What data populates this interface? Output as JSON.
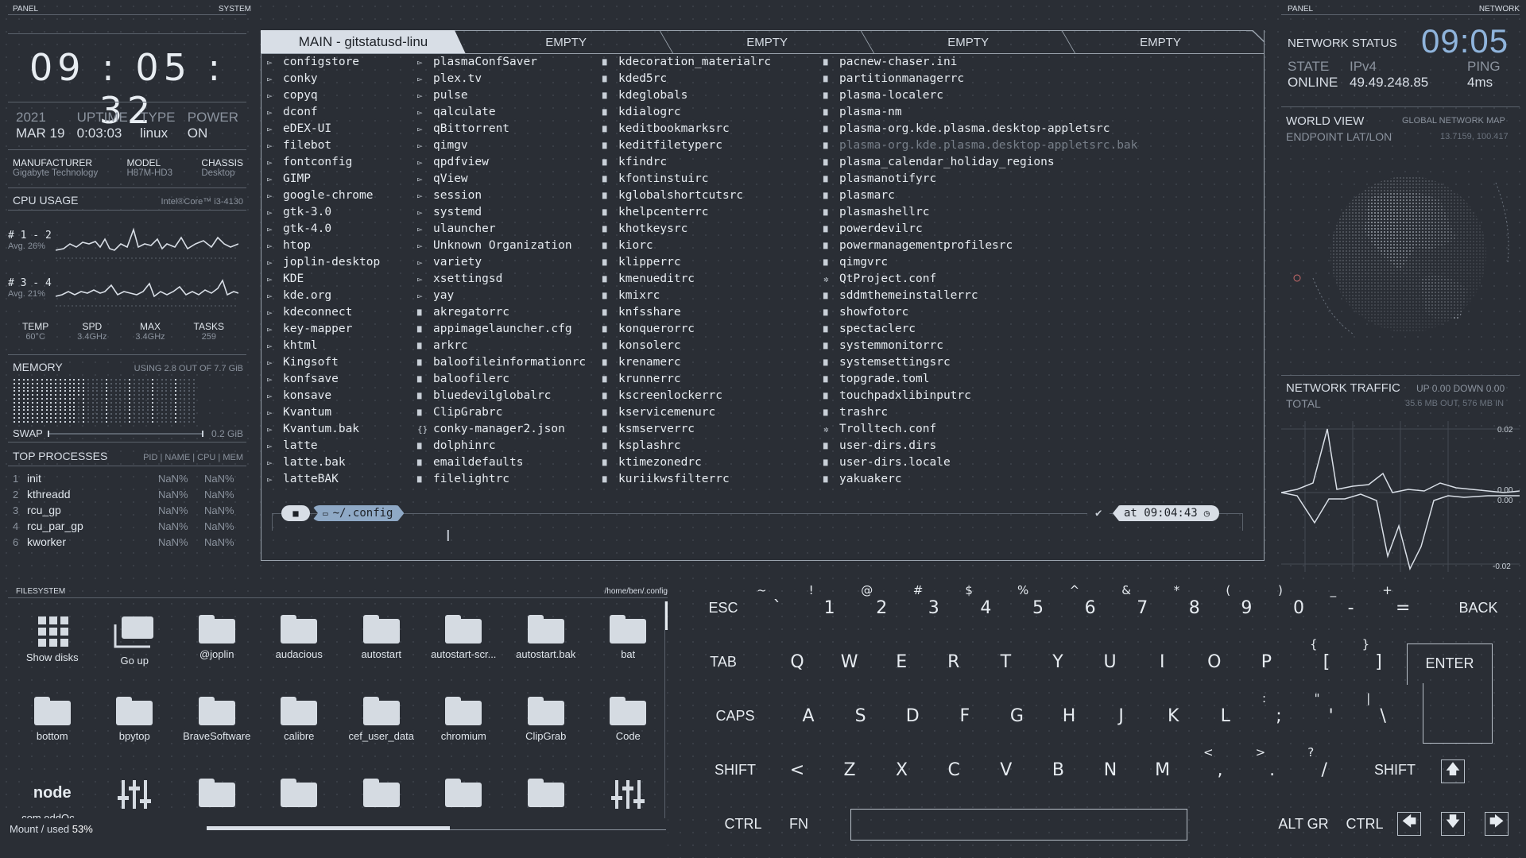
{
  "left_panel": {
    "header_left": "PANEL",
    "header_right": "SYSTEM",
    "clock": [
      "09",
      "05",
      "32"
    ],
    "info": [
      {
        "k": "2021",
        "v": "MAR 19"
      },
      {
        "k": "UPTIME",
        "v": "0:03:03"
      },
      {
        "k": "TYPE",
        "v": "linux"
      },
      {
        "k": "POWER",
        "v": "ON"
      }
    ],
    "hardware": [
      {
        "k": "MANUFACTURER",
        "v": "Gigabyte Technology"
      },
      {
        "k": "MODEL",
        "v": "H87M-HD3"
      },
      {
        "k": "CHASSIS",
        "v": "Desktop"
      }
    ],
    "cpu_title": "CPU USAGE",
    "cpu_model": "Intel®Core™ i3-4130",
    "cpu_rows": [
      {
        "cores": "# 1 - 2",
        "avg": "Avg. 26%"
      },
      {
        "cores": "# 3 - 4",
        "avg": "Avg. 21%"
      }
    ],
    "stats": [
      {
        "k": "TEMP",
        "v": "60°C"
      },
      {
        "k": "SPD",
        "v": "3.4GHz"
      },
      {
        "k": "MAX",
        "v": "3.4GHz"
      },
      {
        "k": "TASKS",
        "v": "259"
      }
    ],
    "memory_title": "MEMORY",
    "memory_usage": "USING 2.8 OUT OF 7.7 GiB",
    "memory_used_fraction": 0.36,
    "swap_label": "SWAP",
    "swap_value": "0.2 GiB",
    "processes_title": "TOP PROCESSES",
    "processes_cols": "PID | NAME | CPU | MEM",
    "processes": [
      {
        "pid": "1",
        "name": "init",
        "cpu": "NaN%",
        "mem": "NaN%"
      },
      {
        "pid": "2",
        "name": "kthreadd",
        "cpu": "NaN%",
        "mem": "NaN%"
      },
      {
        "pid": "3",
        "name": "rcu_gp",
        "cpu": "NaN%",
        "mem": "NaN%"
      },
      {
        "pid": "4",
        "name": "rcu_par_gp",
        "cpu": "NaN%",
        "mem": "NaN%"
      },
      {
        "pid": "6",
        "name": "kworker",
        "cpu": "NaN%",
        "mem": "NaN%"
      }
    ]
  },
  "terminal": {
    "tabs": [
      "MAIN - gitstatusd-linu",
      "EMPTY",
      "EMPTY",
      "EMPTY",
      "EMPTY"
    ],
    "columns": [
      [
        {
          "t": "d",
          "n": "configstore"
        },
        {
          "t": "d",
          "n": "conky"
        },
        {
          "t": "d",
          "n": "copyq"
        },
        {
          "t": "d",
          "n": "dconf"
        },
        {
          "t": "d",
          "n": "eDEX-UI"
        },
        {
          "t": "d",
          "n": "filebot"
        },
        {
          "t": "d",
          "n": "fontconfig"
        },
        {
          "t": "d",
          "n": "GIMP"
        },
        {
          "t": "d",
          "n": "google-chrome"
        },
        {
          "t": "d",
          "n": "gtk-3.0"
        },
        {
          "t": "d",
          "n": "gtk-4.0"
        },
        {
          "t": "d",
          "n": "htop"
        },
        {
          "t": "d",
          "n": "joplin-desktop"
        },
        {
          "t": "d",
          "n": "KDE"
        },
        {
          "t": "d",
          "n": "kde.org"
        },
        {
          "t": "d",
          "n": "kdeconnect"
        },
        {
          "t": "d",
          "n": "key-mapper"
        },
        {
          "t": "d",
          "n": "khtml"
        },
        {
          "t": "d",
          "n": "Kingsoft"
        },
        {
          "t": "d",
          "n": "konfsave"
        },
        {
          "t": "d",
          "n": "konsave"
        },
        {
          "t": "d",
          "n": "Kvantum"
        },
        {
          "t": "d",
          "n": "Kvantum.bak"
        },
        {
          "t": "d",
          "n": "latte"
        },
        {
          "t": "d",
          "n": "latte.bak"
        },
        {
          "t": "d",
          "n": "latteBAK"
        }
      ],
      [
        {
          "t": "d",
          "n": "plasmaConfSaver"
        },
        {
          "t": "d",
          "n": "plex.tv"
        },
        {
          "t": "d",
          "n": "pulse"
        },
        {
          "t": "d",
          "n": "qalculate"
        },
        {
          "t": "d",
          "n": "qBittorrent"
        },
        {
          "t": "d",
          "n": "qimgv"
        },
        {
          "t": "d",
          "n": "qpdfview"
        },
        {
          "t": "d",
          "n": "qView"
        },
        {
          "t": "d",
          "n": "session"
        },
        {
          "t": "d",
          "n": "systemd"
        },
        {
          "t": "d",
          "n": "ulauncher"
        },
        {
          "t": "d",
          "n": "Unknown Organization"
        },
        {
          "t": "d",
          "n": "variety"
        },
        {
          "t": "d",
          "n": "xsettingsd"
        },
        {
          "t": "d",
          "n": "yay"
        },
        {
          "t": "f",
          "n": "akregatorrc"
        },
        {
          "t": "f",
          "n": "appimagelauncher.cfg"
        },
        {
          "t": "f",
          "n": "arkrc"
        },
        {
          "t": "f",
          "n": "baloofileinformationrc"
        },
        {
          "t": "f",
          "n": "baloofilerc"
        },
        {
          "t": "f",
          "n": "bluedevilglobalrc"
        },
        {
          "t": "f",
          "n": "ClipGrabrc"
        },
        {
          "t": "j",
          "n": "conky-manager2.json"
        },
        {
          "t": "f",
          "n": "dolphinrc"
        },
        {
          "t": "f",
          "n": "emaildefaults"
        },
        {
          "t": "f",
          "n": "filelightrc"
        }
      ],
      [
        {
          "t": "f",
          "n": "kdecoration_materialrc"
        },
        {
          "t": "f",
          "n": "kded5rc"
        },
        {
          "t": "f",
          "n": "kdeglobals"
        },
        {
          "t": "f",
          "n": "kdialogrc"
        },
        {
          "t": "f",
          "n": "keditbookmarksrc"
        },
        {
          "t": "f",
          "n": "keditfiletyperc"
        },
        {
          "t": "f",
          "n": "kfindrc"
        },
        {
          "t": "f",
          "n": "kfontinstuirc"
        },
        {
          "t": "f",
          "n": "kglobalshortcutsrc"
        },
        {
          "t": "f",
          "n": "khelpcenterrc"
        },
        {
          "t": "f",
          "n": "khotkeysrc"
        },
        {
          "t": "f",
          "n": "kiorc"
        },
        {
          "t": "f",
          "n": "klipperrc"
        },
        {
          "t": "f",
          "n": "kmenueditrc"
        },
        {
          "t": "f",
          "n": "kmixrc"
        },
        {
          "t": "f",
          "n": "knfsshare"
        },
        {
          "t": "f",
          "n": "konquerorrc"
        },
        {
          "t": "f",
          "n": "konsolerc"
        },
        {
          "t": "f",
          "n": "krenamerc"
        },
        {
          "t": "f",
          "n": "krunnerrc"
        },
        {
          "t": "f",
          "n": "kscreenlockerrc"
        },
        {
          "t": "f",
          "n": "kservicemenurc"
        },
        {
          "t": "f",
          "n": "ksmserverrc"
        },
        {
          "t": "f",
          "n": "ksplashrc"
        },
        {
          "t": "f",
          "n": "ktimezonedrc"
        },
        {
          "t": "f",
          "n": "kuriikwsfilterrc"
        }
      ],
      [
        {
          "t": "f",
          "n": "pacnew-chaser.ini"
        },
        {
          "t": "f",
          "n": "partitionmanagerrc"
        },
        {
          "t": "f",
          "n": "plasma-localerc"
        },
        {
          "t": "f",
          "n": "plasma-nm"
        },
        {
          "t": "f",
          "n": "plasma-org.kde.plasma.desktop-appletsrc"
        },
        {
          "t": "b",
          "n": "plasma-org.kde.plasma.desktop-appletsrc.bak"
        },
        {
          "t": "f",
          "n": "plasma_calendar_holiday_regions"
        },
        {
          "t": "f",
          "n": "plasmanotifyrc"
        },
        {
          "t": "f",
          "n": "plasmarc"
        },
        {
          "t": "f",
          "n": "plasmashellrc"
        },
        {
          "t": "f",
          "n": "powerdevilrc"
        },
        {
          "t": "f",
          "n": "powermanagementprofilesrc"
        },
        {
          "t": "f",
          "n": "qimgvrc"
        },
        {
          "t": "g",
          "n": "QtProject.conf"
        },
        {
          "t": "f",
          "n": "sddmthemeinstallerrc"
        },
        {
          "t": "f",
          "n": "showfotorc"
        },
        {
          "t": "f",
          "n": "spectaclerc"
        },
        {
          "t": "f",
          "n": "systemmonitorrc"
        },
        {
          "t": "f",
          "n": "systemsettingsrc"
        },
        {
          "t": "f",
          "n": "topgrade.toml"
        },
        {
          "t": "f",
          "n": "touchpadxlibinputrc"
        },
        {
          "t": "f",
          "n": "trashrc"
        },
        {
          "t": "g",
          "n": "Trolltech.conf"
        },
        {
          "t": "f",
          "n": "user-dirs.dirs"
        },
        {
          "t": "f",
          "n": "user-dirs.locale"
        },
        {
          "t": "f",
          "n": "yakuakerc"
        }
      ]
    ],
    "prompt_path": "~/.config",
    "prompt_time": "at 09:04:43"
  },
  "right_panel": {
    "header_left": "PANEL",
    "header_right": "NETWORK",
    "status_title": "NETWORK STATUS",
    "clock": "09:05",
    "state_k": "STATE",
    "state_v": "ONLINE",
    "ip_k": "IPv4",
    "ip_v": "49.49.248.85",
    "ping_k": "PING",
    "ping_v": "4ms",
    "world_title": "WORLD VIEW",
    "world_sub": "GLOBAL NETWORK MAP",
    "endpoint_k": "ENDPOINT LAT/LON",
    "endpoint_v": "13.7159, 100.417",
    "traffic_title": "NETWORK TRAFFIC",
    "traffic_rate": "UP 0.00 DOWN 0.00",
    "total_k": "TOTAL",
    "total_v": "35.6 MB OUT, 576 MB IN",
    "graph_labels": [
      "0.02",
      "0.00",
      "0.00",
      "-0.02"
    ]
  },
  "filesystem": {
    "title": "FILESYSTEM",
    "path": "/home/ben/.config",
    "items": [
      {
        "n": "Show disks",
        "i": "grid"
      },
      {
        "n": "Go up",
        "i": "up"
      },
      {
        "n": "@joplin",
        "i": "folder"
      },
      {
        "n": "audacious",
        "i": "folder"
      },
      {
        "n": "autostart",
        "i": "folder"
      },
      {
        "n": "autostart-scr...",
        "i": "folder"
      },
      {
        "n": "autostart.bak",
        "i": "folder"
      },
      {
        "n": "bat",
        "i": "folder"
      },
      {
        "n": "bottom",
        "i": "folder"
      },
      {
        "n": "bpytop",
        "i": "folder"
      },
      {
        "n": "BraveSoftware",
        "i": "folder"
      },
      {
        "n": "calibre",
        "i": "folder"
      },
      {
        "n": "cef_user_data",
        "i": "folder"
      },
      {
        "n": "chromium",
        "i": "folder"
      },
      {
        "n": "ClipGrab",
        "i": "folder"
      },
      {
        "n": "Code",
        "i": "folder"
      },
      {
        "n": "com.oddOc...",
        "i": "node"
      },
      {
        "n": "",
        "i": "sliders"
      },
      {
        "n": "",
        "i": "folder"
      },
      {
        "n": "",
        "i": "folder"
      },
      {
        "n": "",
        "i": "folder"
      },
      {
        "n": "",
        "i": "folder"
      },
      {
        "n": "",
        "i": "folder"
      },
      {
        "n": "",
        "i": "sliders"
      }
    ],
    "mount_label": "Mount / used",
    "mount_value": "53%",
    "mount_fraction": 0.53
  },
  "keyboard": {
    "row1": [
      [
        "~",
        "`"
      ],
      [
        "!",
        "1"
      ],
      [
        "@",
        "2"
      ],
      [
        "#",
        "3"
      ],
      [
        "$",
        "4"
      ],
      [
        "%",
        "5"
      ],
      [
        "^",
        "6"
      ],
      [
        "&",
        "7"
      ],
      [
        "*",
        "8"
      ],
      [
        "(",
        "9"
      ],
      [
        ")",
        "0"
      ],
      [
        "_",
        "-"
      ],
      [
        "+",
        "="
      ]
    ],
    "row2": [
      "Q",
      "W",
      "E",
      "R",
      "T",
      "Y",
      "U",
      "I",
      "O",
      "P"
    ],
    "row2b": [
      [
        "{",
        "["
      ],
      [
        "}",
        "]"
      ]
    ],
    "row3": [
      "A",
      "S",
      "D",
      "F",
      "G",
      "H",
      "J",
      "K",
      "L"
    ],
    "row3b": [
      [
        ":",
        ";"
      ],
      [
        "\"",
        "'"
      ],
      [
        "|",
        "\\"
      ]
    ],
    "row4": [
      "Z",
      "X",
      "C",
      "V",
      "B",
      "N",
      "M"
    ],
    "row4b": [
      [
        "<",
        ","
      ],
      [
        ">",
        "."
      ],
      [
        "?",
        "/"
      ]
    ],
    "esc": "ESC",
    "back": "BACK",
    "tab": "TAB",
    "enter": "ENTER",
    "caps": "CAPS",
    "shift_l": "SHIFT",
    "shift_r": "SHIFT",
    "ctrl_l": "CTRL",
    "fn": "FN",
    "altgr": "ALT GR",
    "ctrl_r": "CTRL",
    "arrows": {
      "up": "🡅",
      "left": "🡄",
      "down": "🡇",
      "right": "🡆"
    }
  }
}
